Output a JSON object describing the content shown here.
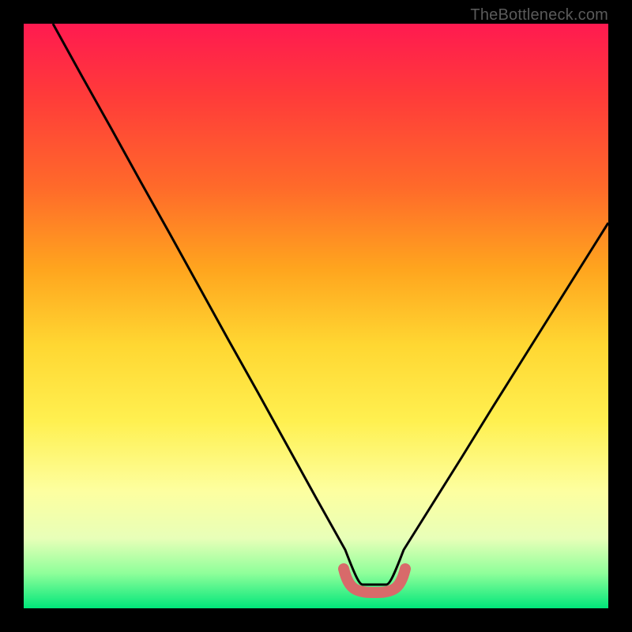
{
  "watermark": "TheBottleneck.com",
  "chart_data": {
    "type": "line",
    "title": "",
    "xlabel": "",
    "ylabel": "",
    "xlim": [
      0,
      1
    ],
    "ylim": [
      0,
      1
    ],
    "series": [
      {
        "name": "bottleneck-curve",
        "x": [
          0.05,
          0.1,
          0.15,
          0.2,
          0.25,
          0.3,
          0.35,
          0.4,
          0.45,
          0.5,
          0.55,
          0.58,
          0.62,
          0.65,
          0.7,
          0.75,
          0.8,
          0.85,
          0.9,
          0.95,
          1.0
        ],
        "y": [
          1.0,
          0.91,
          0.82,
          0.73,
          0.64,
          0.55,
          0.46,
          0.37,
          0.28,
          0.19,
          0.1,
          0.04,
          0.04,
          0.1,
          0.18,
          0.26,
          0.34,
          0.42,
          0.5,
          0.58,
          0.66
        ]
      },
      {
        "name": "optimal-range-marker",
        "x": [
          0.55,
          0.56,
          0.58,
          0.6,
          0.62,
          0.64,
          0.65
        ],
        "y": [
          0.07,
          0.04,
          0.03,
          0.03,
          0.03,
          0.04,
          0.07
        ]
      }
    ],
    "gradient_stops": [
      {
        "pos": 0.0,
        "color": "#ff1a50"
      },
      {
        "pos": 0.12,
        "color": "#ff3a3a"
      },
      {
        "pos": 0.28,
        "color": "#ff6a2a"
      },
      {
        "pos": 0.42,
        "color": "#ffa51e"
      },
      {
        "pos": 0.55,
        "color": "#ffd732"
      },
      {
        "pos": 0.68,
        "color": "#fff050"
      },
      {
        "pos": 0.8,
        "color": "#fdffa0"
      },
      {
        "pos": 0.88,
        "color": "#e8ffb8"
      },
      {
        "pos": 0.94,
        "color": "#8fff9a"
      },
      {
        "pos": 1.0,
        "color": "#00e67a"
      }
    ]
  }
}
